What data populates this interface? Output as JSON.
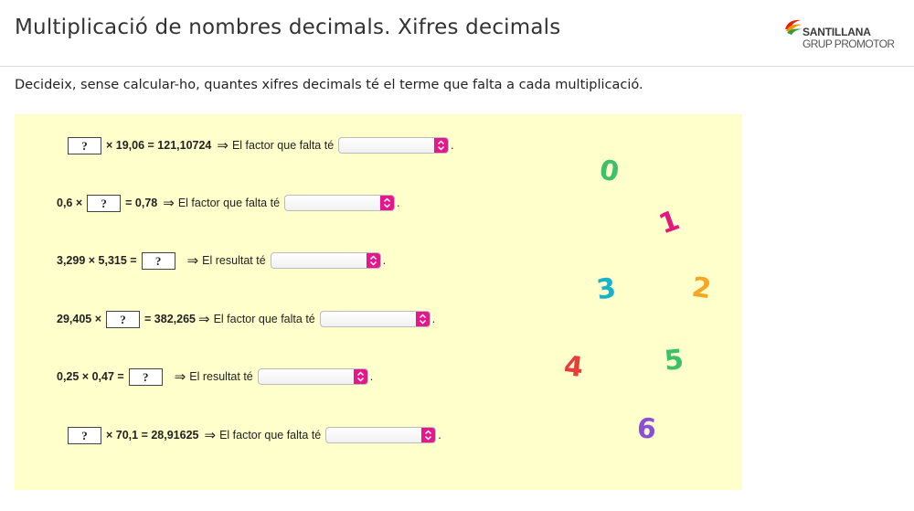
{
  "page": {
    "title": "Multiplicació de nombres decimals. Xifres decimals",
    "instructions": "Decideix, sense calcular-ho, quantes xifres decimals té el terme que falta a cada multiplicació."
  },
  "logo": {
    "name": "SANTILLANA",
    "subtitle": "GRUP PROMOTOR"
  },
  "exercises": [
    {
      "before": "",
      "blank": "?",
      "after": "× 19,06 = 121,10724",
      "arrow": "⇒",
      "label": "El factor que falta té",
      "selected": "",
      "end": "."
    },
    {
      "before": "0,6 ×",
      "blank": "?",
      "after": "= 0,78",
      "arrow": "⇒",
      "label": "El factor que falta té",
      "selected": "",
      "end": "."
    },
    {
      "before": "3,299 × 5,315 =",
      "blank": "?",
      "after": "",
      "arrow": "⇒",
      "label": "El resultat té",
      "selected": "",
      "end": "."
    },
    {
      "before": "29,405 ×",
      "blank": "?",
      "after": "= 382,265",
      "arrow": "⇒",
      "label": "El factor que falta té",
      "selected": "",
      "end": "."
    },
    {
      "before": "0,25 × 0,47 =",
      "blank": "?",
      "after": "",
      "arrow": "⇒",
      "label": "El resultat té",
      "selected": "",
      "end": "."
    },
    {
      "before": "",
      "blank": "?",
      "after": "× 70,1 = 28,91625",
      "arrow": "⇒",
      "label": "El factor que falta té",
      "selected": "",
      "end": "."
    }
  ],
  "digits": [
    {
      "value": "0",
      "color": "#3cc06a"
    },
    {
      "value": "1",
      "color": "#e2187f"
    },
    {
      "value": "3",
      "color": "#18b3c9"
    },
    {
      "value": "2",
      "color": "#f5a623"
    },
    {
      "value": "4",
      "color": "#e63c3c"
    },
    {
      "value": "5",
      "color": "#3cc06a"
    },
    {
      "value": "6",
      "color": "#8a4fd6"
    }
  ],
  "colors": {
    "panel_background": "#ffffcc",
    "select_button": "#e6178d"
  }
}
